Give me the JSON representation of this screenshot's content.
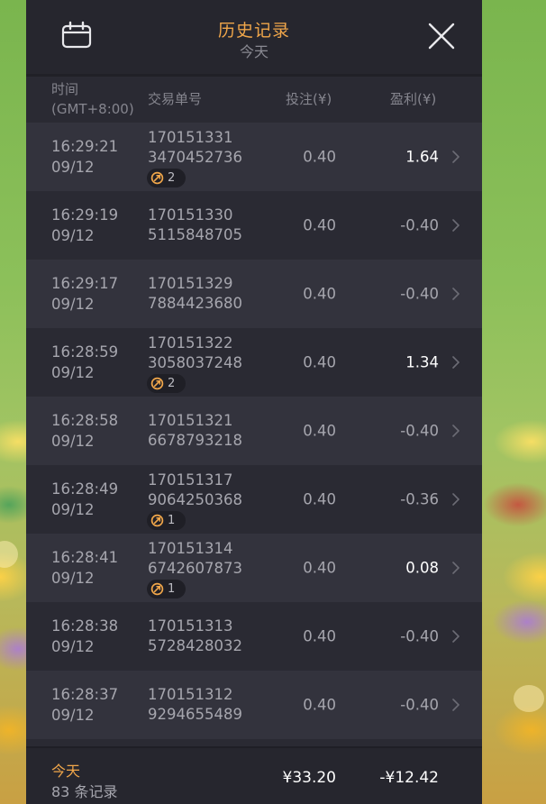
{
  "header": {
    "title": "历史记录",
    "subtitle": "今天"
  },
  "columns": {
    "time_line1": "时间",
    "time_line2": "(GMT+8:00)",
    "order": "交易单号",
    "bet": "投注(¥)",
    "profit": "盈利(¥)"
  },
  "rows": [
    {
      "time": "16:29:21",
      "date": "09/12",
      "order1": "170151331",
      "order2": "3470452736",
      "badge": "2",
      "bet": "0.40",
      "profit": "1.64",
      "win": true
    },
    {
      "time": "16:29:19",
      "date": "09/12",
      "order1": "170151330",
      "order2": "5115848705",
      "badge": null,
      "bet": "0.40",
      "profit": "-0.40",
      "win": false
    },
    {
      "time": "16:29:17",
      "date": "09/12",
      "order1": "170151329",
      "order2": "7884423680",
      "badge": null,
      "bet": "0.40",
      "profit": "-0.40",
      "win": false
    },
    {
      "time": "16:28:59",
      "date": "09/12",
      "order1": "170151322",
      "order2": "3058037248",
      "badge": "2",
      "bet": "0.40",
      "profit": "1.34",
      "win": true
    },
    {
      "time": "16:28:58",
      "date": "09/12",
      "order1": "170151321",
      "order2": "6678793218",
      "badge": null,
      "bet": "0.40",
      "profit": "-0.40",
      "win": false
    },
    {
      "time": "16:28:49",
      "date": "09/12",
      "order1": "170151317",
      "order2": "9064250368",
      "badge": "1",
      "bet": "0.40",
      "profit": "-0.36",
      "win": false
    },
    {
      "time": "16:28:41",
      "date": "09/12",
      "order1": "170151314",
      "order2": "6742607873",
      "badge": "1",
      "bet": "0.40",
      "profit": "0.08",
      "win": true
    },
    {
      "time": "16:28:38",
      "date": "09/12",
      "order1": "170151313",
      "order2": "5728428032",
      "badge": null,
      "bet": "0.40",
      "profit": "-0.40",
      "win": false
    },
    {
      "time": "16:28:37",
      "date": "09/12",
      "order1": "170151312",
      "order2": "9294655489",
      "badge": null,
      "bet": "0.40",
      "profit": "-0.40",
      "win": false
    }
  ],
  "footer": {
    "label": "今天",
    "count": "83 条记录",
    "bet_total": "¥33.20",
    "profit_total": "-¥12.42"
  },
  "icons": {
    "calendar": "calendar-icon",
    "close": "close-icon",
    "chevron": "chevron-right-icon",
    "badge": "free-spin-icon"
  },
  "colors": {
    "accent": "#f0a64a",
    "panel_bg": "#2a2a33",
    "row_alt": "#33333d",
    "text_dim": "#a6a6ae",
    "text_win": "#ffffff"
  }
}
